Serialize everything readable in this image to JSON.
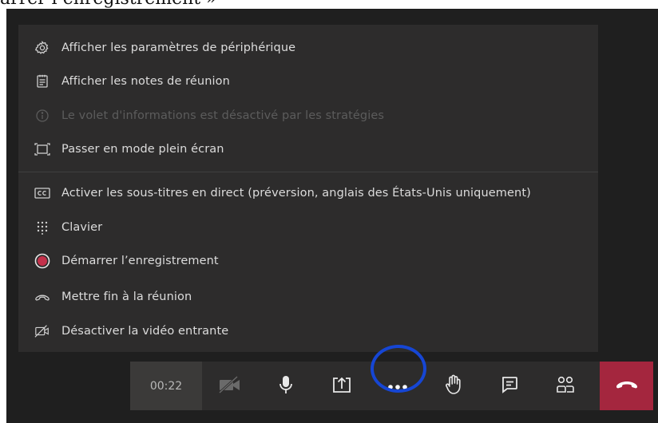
{
  "caption": {
    "text": "arrer l’enregistrement »"
  },
  "menu": {
    "items": [
      {
        "icon": "gear-icon",
        "label": "Afficher les paramètres de périphérique",
        "enabled": true
      },
      {
        "icon": "notes-icon",
        "label": "Afficher les notes de réunion",
        "enabled": true
      },
      {
        "icon": "info-icon",
        "label": "Le volet d'informations est désactivé par les stratégies",
        "enabled": false
      },
      {
        "icon": "fullscreen-icon",
        "label": "Passer en mode plein écran",
        "enabled": true
      },
      {
        "icon": "closed-captions-icon",
        "label": "Activer les sous-titres en direct (préversion, anglais des États-Unis uniquement)",
        "enabled": true
      },
      {
        "icon": "keypad-icon",
        "label": "Clavier",
        "enabled": true
      },
      {
        "icon": "record-icon",
        "label": "Démarrer l’enregistrement",
        "enabled": true
      },
      {
        "icon": "hang-up-icon",
        "label": "Mettre fin à la réunion",
        "enabled": true
      },
      {
        "icon": "video-off-icon",
        "label": "Désactiver la vidéo entrante",
        "enabled": true
      }
    ]
  },
  "toolbar": {
    "timer": "00:22",
    "buttons": [
      "camera-off-icon",
      "microphone-icon",
      "share-screen-icon",
      "more-options-icon",
      "raise-hand-icon",
      "chat-icon",
      "participants-icon",
      "hang-up-icon"
    ]
  },
  "colors": {
    "background": "#1f1f1f",
    "menu": "#2d2c2c",
    "hangup": "#a4263e",
    "record": "#c4314b",
    "highlight_ring": "#1646d4"
  }
}
